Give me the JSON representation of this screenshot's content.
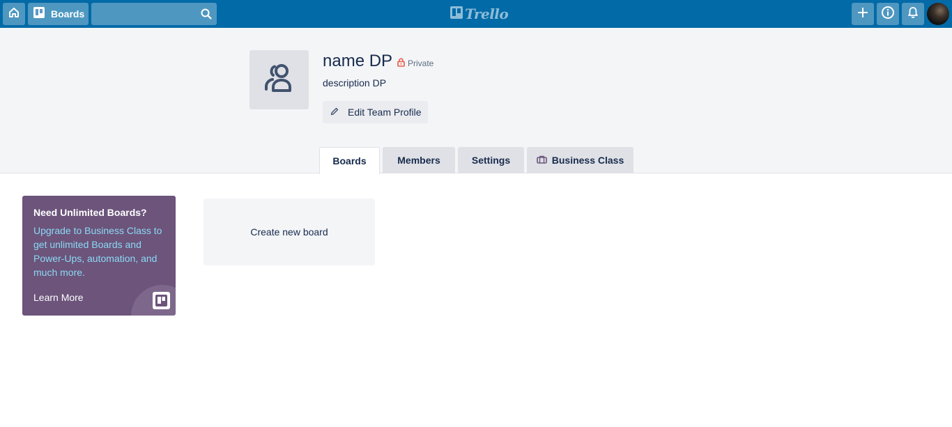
{
  "header": {
    "boards_label": "Boards",
    "search_value": "",
    "logo_text": "Trello"
  },
  "team": {
    "name": "name DP",
    "privacy": "Private",
    "description": "description DP",
    "edit_label": "Edit Team Profile"
  },
  "tabs": [
    {
      "label": "Boards",
      "active": true
    },
    {
      "label": "Members",
      "active": false
    },
    {
      "label": "Settings",
      "active": false
    },
    {
      "label": "Business Class",
      "active": false
    }
  ],
  "upsell": {
    "title": "Need Unlimited Boards?",
    "body": "Upgrade to Business Class to get unlimited Boards and Power-Ups, automation, and much more.",
    "learn_more": "Learn More"
  },
  "create_board_label": "Create new board",
  "colors": {
    "header": "#026aa7",
    "band": "#f4f5f7",
    "upsell_bg": "#6c547b",
    "upsell_text": "#8bd9f5",
    "lock": "#eb5a46"
  }
}
